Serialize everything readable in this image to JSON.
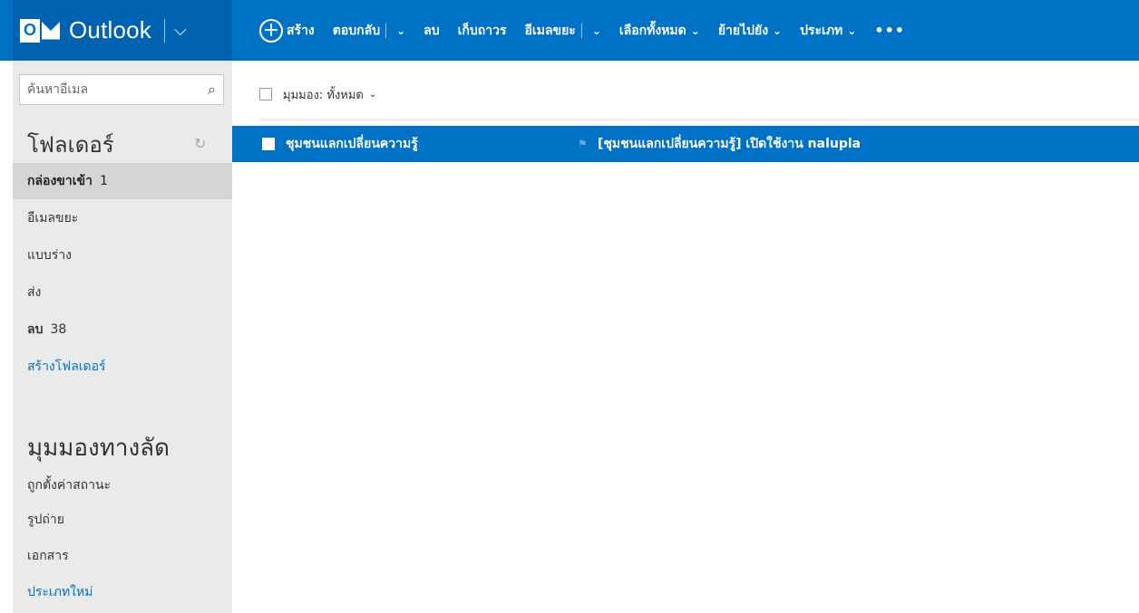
{
  "app": {
    "brand_name": "Outlook"
  },
  "toolbar": {
    "new_label": "สร้าง",
    "reply_label": "ตอบกลับ",
    "delete_label": "ลบ",
    "archive_label": "เก็บถาวร",
    "junk_label": "อีเมลขยะ",
    "select_all_label": "เลือกทั้งหมด",
    "move_to_label": "ย้ายไปยัง",
    "categories_label": "ประเภท",
    "more_label": "•••"
  },
  "sidebar": {
    "search_placeholder": "ค้นหาอีเมล",
    "folders_title": "โฟลเดอร์",
    "folders": [
      {
        "label": "กล่องขาเข้า",
        "count": "1"
      },
      {
        "label": "อีเมลขยะ",
        "count": ""
      },
      {
        "label": "แบบร่าง",
        "count": ""
      },
      {
        "label": "ส่ง",
        "count": ""
      },
      {
        "label": "ลบ",
        "count": "38"
      }
    ],
    "new_folder_label": "สร้างโฟลเดอร์",
    "quick_views_title": "มุมมองทางลัด",
    "quick_views": [
      {
        "label": "ถูกตั้งค่าสถานะ"
      },
      {
        "label": "รูปถ่าย"
      },
      {
        "label": "เอกสาร"
      }
    ],
    "new_category_label": "ประเภทใหม่"
  },
  "message_list": {
    "view_label": "มุมมอง: ทั้งหมด",
    "messages": [
      {
        "from": "ชุมชนแลกเปลี่ยนความรู้",
        "subject": "[ชุมชนแลกเปลี่ยนความรู้] เปิดใช้งาน nalupla"
      }
    ]
  },
  "colors": {
    "accent": "#0072c6",
    "brand_dark": "#0063b1",
    "sidebar_bg": "#eaeaea",
    "selected_folder_bg": "#d5d5d5",
    "link": "#0072c6"
  },
  "icons": [
    "outlook-logo-icon",
    "chevron-down-icon",
    "plus-circle-icon",
    "search-icon",
    "refresh-icon",
    "flag-icon",
    "more-icon"
  ]
}
